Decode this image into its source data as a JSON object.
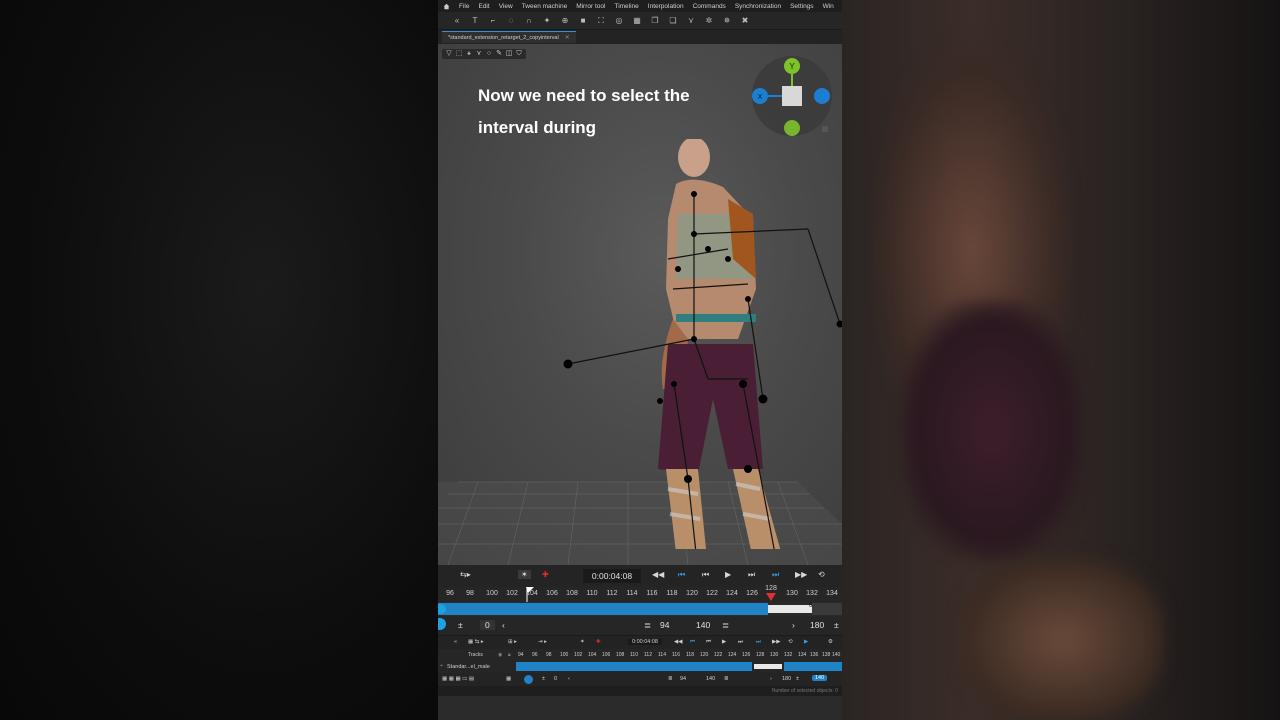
{
  "menu": {
    "items": [
      "File",
      "Edit",
      "View",
      "Tween machine",
      "Mirror tool",
      "Timeline",
      "Interpolation",
      "Commands",
      "Synchronization",
      "Settings",
      "Win"
    ]
  },
  "tab": {
    "label": "*standard_extension_retarget_2_copyinterval"
  },
  "caption": {
    "text": "Now we need to select the interval during"
  },
  "gizmo": {
    "y_label": "Y",
    "x_label": "X"
  },
  "transport": {
    "time": "0:00:04:08"
  },
  "ruler": {
    "ticks": [
      "96",
      "98",
      "100",
      "102",
      "104",
      "106",
      "108",
      "110",
      "112",
      "114",
      "116",
      "118",
      "120",
      "122",
      "124",
      "126",
      "128",
      "130",
      "132",
      "134"
    ],
    "current_frame": "128",
    "selection_marker": "6"
  },
  "range": {
    "start": "0",
    "range_start": "94",
    "range_end": "140",
    "end": "180"
  },
  "mini": {
    "time": "0:00:04:08",
    "tracks_label": "Tracks",
    "track_name": "Standar...el_male",
    "ticks": [
      "94",
      "96",
      "98",
      "100",
      "102",
      "104",
      "106",
      "108",
      "110",
      "112",
      "114",
      "116",
      "118",
      "120",
      "122",
      "124",
      "126",
      "128",
      "130",
      "132",
      "134",
      "136",
      "138",
      "140"
    ],
    "start": "0",
    "range_start": "94",
    "range_end": "140",
    "end": "180",
    "end_badge": "140"
  },
  "status": {
    "text": "Number of selected objects: 0"
  },
  "colors": {
    "accent": "#1f83c6",
    "playhead": "#e03030",
    "axis_y": "#7cc22a",
    "axis_x": "#1a7fd0"
  }
}
